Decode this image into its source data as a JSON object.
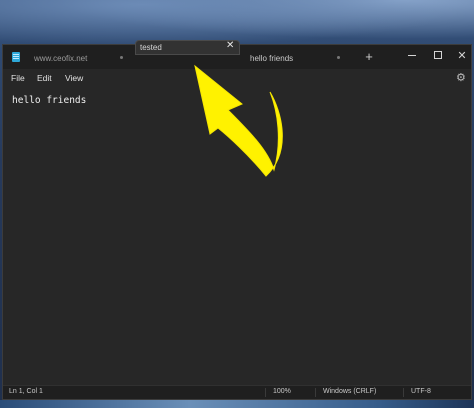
{
  "titlebar": {
    "tabs": [
      {
        "label": "www.ceofix.net"
      },
      {
        "label": "hello friends"
      }
    ],
    "new_tab_glyph": "+",
    "minimize_label": "minimize",
    "maximize_label": "maximize",
    "close_glyph": "✕"
  },
  "dragged_tab": {
    "label": "tested",
    "close_glyph": "✕"
  },
  "menu": {
    "file": "File",
    "edit": "Edit",
    "view": "View",
    "settings_glyph": "⚙"
  },
  "editor": {
    "content": "hello friends"
  },
  "status": {
    "position": "Ln 1, Col 1",
    "zoom": "100%",
    "line_ending": "Windows (CRLF)",
    "encoding": "UTF-8"
  },
  "colors": {
    "arrow": "#fff200",
    "editor_bg": "#272727",
    "titlebar_bg": "#1f1f1f"
  },
  "icons": [
    "notepad-app-icon",
    "settings-gear-icon",
    "close-icon",
    "plus-icon",
    "annotation-arrow-icon"
  ]
}
